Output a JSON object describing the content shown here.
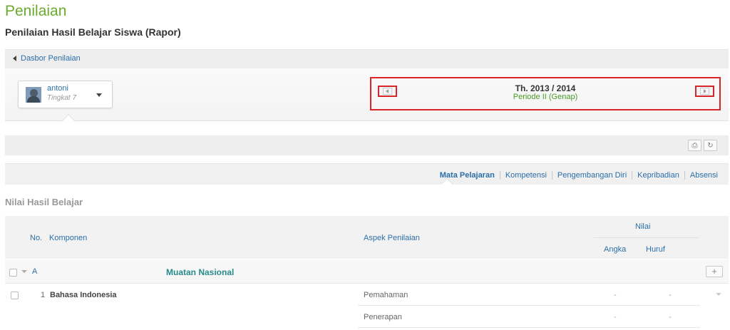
{
  "page": {
    "title": "Penilaian",
    "subtitle": "Penilaian Hasil Belajar Siswa (Rapor)"
  },
  "breadcrumb": {
    "back_label": "Dasbor Penilaian",
    "icon": "triangle-left-icon"
  },
  "student": {
    "name": "antoni",
    "grade": "Tingkat 7"
  },
  "period": {
    "year": "Th. 2013 / 2014",
    "term": "Periode II (Genap)"
  },
  "toolbar": {
    "print_icon": "⎙",
    "refresh_icon": "↻"
  },
  "tabs": [
    {
      "label": "Mata Pelajaran",
      "active": true
    },
    {
      "label": "Kompetensi",
      "active": false
    },
    {
      "label": "Pengembangan Diri",
      "active": false
    },
    {
      "label": "Kepribadian",
      "active": false
    },
    {
      "label": "Absensi",
      "active": false
    }
  ],
  "section": {
    "title": "Nilai Hasil Belajar"
  },
  "table": {
    "headers": {
      "no": "No.",
      "komponen": "Komponen",
      "aspek": "Aspek Penilaian",
      "nilai": "Nilai",
      "angka": "Angka",
      "huruf": "Huruf"
    },
    "group": {
      "letter": "A",
      "name": "Muatan Nasional",
      "add_label": "+"
    },
    "rows": [
      {
        "no": "1",
        "subject": "Bahasa Indonesia",
        "aspect": "Pemahaman",
        "angka": "-",
        "huruf": "-"
      },
      {
        "no": "",
        "subject": "",
        "aspect": "Penerapan",
        "angka": "-",
        "huruf": "-"
      }
    ]
  },
  "colors": {
    "accent_green": "#6aab2e",
    "link_blue": "#2a6ea8",
    "highlight_red": "#d9252a"
  }
}
